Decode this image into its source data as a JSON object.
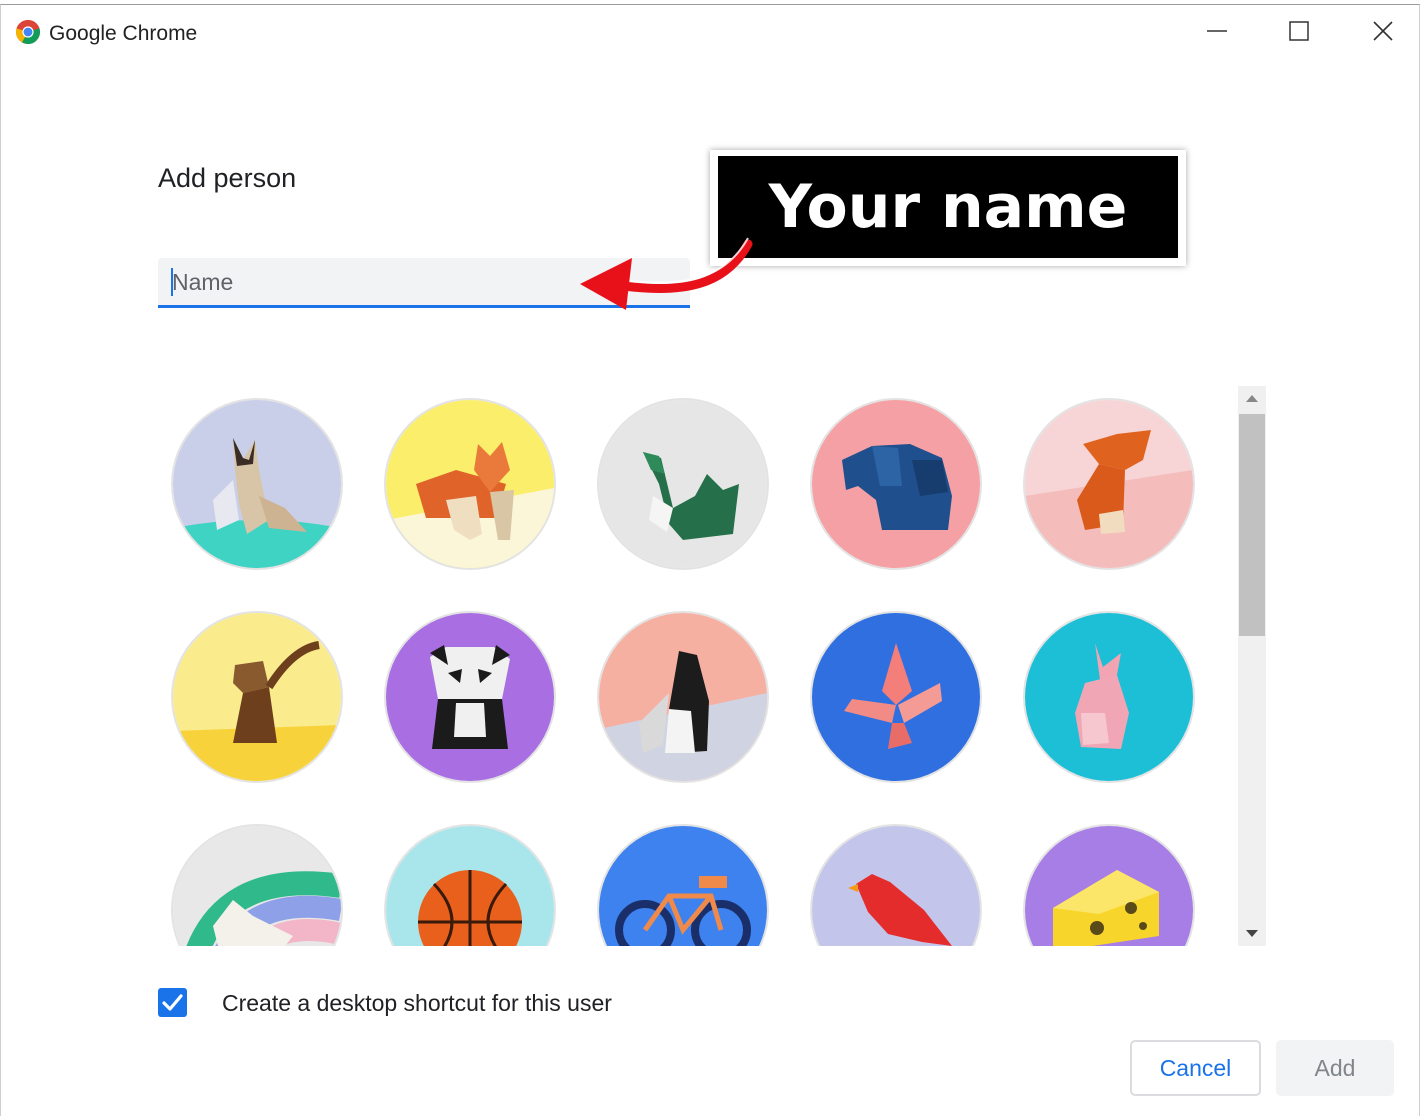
{
  "window": {
    "title": "Google Chrome"
  },
  "dialog": {
    "title": "Add person",
    "name_placeholder": "Name",
    "name_value": ""
  },
  "annotation": {
    "callout_text": "Your name",
    "arrow_color": "#e8111a"
  },
  "avatars": [
    {
      "name": "cat-avatar",
      "bg": "#c9cfe8"
    },
    {
      "name": "corgi-avatar",
      "bg": "#fbee6a"
    },
    {
      "name": "dragon-avatar",
      "bg": "#e6e6e6"
    },
    {
      "name": "elephant-avatar",
      "bg": "#f4a0a4"
    },
    {
      "name": "fox-avatar",
      "bg": "#f7d4d6"
    },
    {
      "name": "monkey-avatar",
      "bg": "#faeb8d"
    },
    {
      "name": "panda-avatar",
      "bg": "#a86ee2"
    },
    {
      "name": "penguin-avatar",
      "bg": "#f6b0a2"
    },
    {
      "name": "butterfly-avatar",
      "bg": "#2f6fe0"
    },
    {
      "name": "rabbit-avatar",
      "bg": "#1cbfd6"
    },
    {
      "name": "unicorn-avatar",
      "bg": "#e8e8e8"
    },
    {
      "name": "basketball-avatar",
      "bg": "#a8e6ec"
    },
    {
      "name": "bicycle-avatar",
      "bg": "#3d82ee"
    },
    {
      "name": "bird-avatar",
      "bg": "#c3c6ea"
    },
    {
      "name": "cheese-avatar",
      "bg": "#a77de6"
    }
  ],
  "shortcut": {
    "checked": true,
    "label": "Create a desktop shortcut for this user"
  },
  "buttons": {
    "cancel": "Cancel",
    "add": "Add"
  },
  "colors": {
    "accent": "#1a73e8",
    "disabled_text": "#80868b"
  }
}
